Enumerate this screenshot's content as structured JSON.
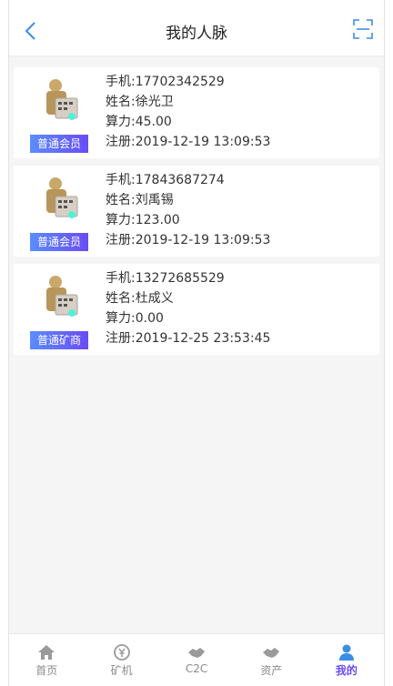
{
  "header": {
    "title": "我的人脉",
    "back_icon": "chevron-left-icon",
    "scan_icon": "scan-icon"
  },
  "members": [
    {
      "badge": "普通会员",
      "phone": "手机:17702342529",
      "name": "姓名:徐光卫",
      "power": "算力:45.00",
      "registered": "注册:2019-12-19 13:09:53"
    },
    {
      "badge": "普通会员",
      "phone": "手机:17843687274",
      "name": "姓名:刘禹锡",
      "power": "算力:123.00",
      "registered": "注册:2019-12-19 13:09:53"
    },
    {
      "badge": "普通矿商",
      "phone": "手机:13272685529",
      "name": "姓名:杜成义",
      "power": "算力:0.00",
      "registered": "注册:2019-12-25 23:53:45"
    }
  ],
  "tabbar": {
    "items": [
      {
        "label": "首页",
        "icon": "home-icon"
      },
      {
        "label": "矿机",
        "icon": "miner-icon"
      },
      {
        "label": "C2C",
        "icon": "handshake-icon"
      },
      {
        "label": "资产",
        "icon": "handshake-icon"
      },
      {
        "label": "我的",
        "icon": "user-icon"
      }
    ],
    "active": "我的"
  },
  "colors": {
    "accent": "#6a4cf5",
    "back_icon": "#3a8ee6",
    "badge_gradient_start": "#5b8cff",
    "badge_gradient_end": "#6a4cf5"
  }
}
